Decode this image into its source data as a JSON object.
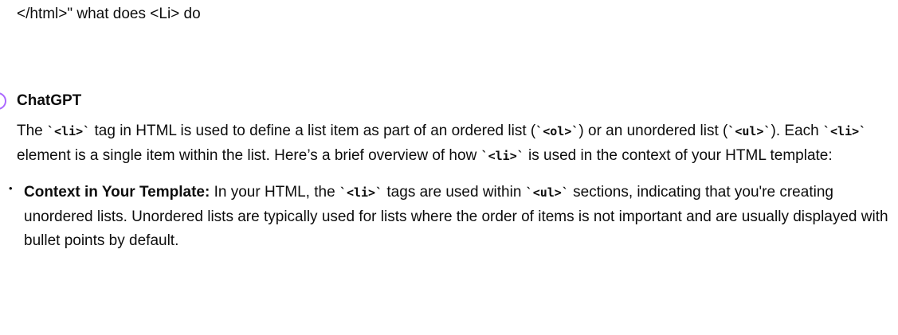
{
  "user_message": {
    "text": "</html>\" what does <Li> do"
  },
  "assistant": {
    "name": "ChatGPT",
    "intro": {
      "t1": "The ",
      "c1": "`<li>`",
      "t2": " tag in HTML is used to define a list item as part of an ordered list (",
      "c2": "`<ol>`",
      "t3": ") or an unordered list (",
      "c3": "`<ul>`",
      "t4": "). Each ",
      "c4": "`<li>`",
      "t5": " element is a single item within the list. Here’s a brief overview of how ",
      "c5": "`<li>`",
      "t6": " is used in the context of your HTML template:"
    },
    "bullets": [
      {
        "marker": "•",
        "title": "Context in Your Template:",
        "t1": " In your HTML, the ",
        "c1": "`<li>`",
        "t2": " tags are used within ",
        "c2": "`<ul>`",
        "t3": " sections, indicating that you're creating unordered lists. Unordered lists are typically used for lists where the order of items is not important and are usually displayed with bullet points by default."
      }
    ]
  }
}
